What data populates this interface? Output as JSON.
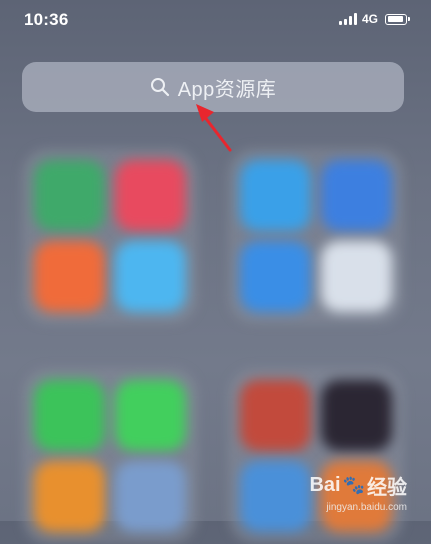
{
  "status_bar": {
    "time": "10:36",
    "network": "4G"
  },
  "search": {
    "label": "App资源库",
    "icon": "search-icon"
  },
  "annotation": {
    "icon": "red-arrow-icon",
    "color": "#e8262e"
  },
  "folders": [
    {
      "name": "folder-top-left",
      "tiles": [
        "#3fa96a",
        "#e84a5f",
        "#f06b3a",
        "#4db6f0"
      ]
    },
    {
      "name": "folder-top-right",
      "tiles": [
        "#3aa0e8",
        "#3d7fe0",
        "#3a8ee6",
        "#d9e0ea"
      ]
    },
    {
      "name": "folder-bottom-left",
      "tiles": [
        "#3cc35a",
        "#42cf5d",
        "#e8902e",
        "#7a9ccc"
      ]
    },
    {
      "name": "folder-bottom-right",
      "tiles": [
        "#c24a3c",
        "#2b2633",
        "#4a90d9",
        "#e07a3a"
      ]
    }
  ],
  "watermark": {
    "brand": "Bai",
    "brand_suffix": "经验",
    "url": "jingyan.baidu.com"
  }
}
